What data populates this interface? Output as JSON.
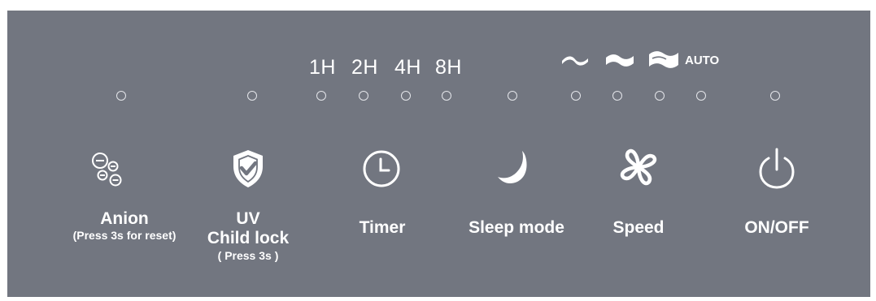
{
  "panel": {
    "background": "#727680",
    "text_color": "#ffffff"
  },
  "timer_options": [
    "1H",
    "2H",
    "4H",
    "8H"
  ],
  "speed_options": {
    "low_icon": "wind-low-icon",
    "mid_icon": "wind-mid-icon",
    "high_icon": "wind-high-icon",
    "auto_label": "AUTO"
  },
  "indicators": [
    {
      "name": "anion-led",
      "state": "off"
    },
    {
      "name": "uv-led",
      "state": "off"
    },
    {
      "name": "timer-1h-led",
      "state": "off"
    },
    {
      "name": "timer-2h-led",
      "state": "off"
    },
    {
      "name": "timer-4h-led",
      "state": "off"
    },
    {
      "name": "timer-8h-led",
      "state": "off"
    },
    {
      "name": "sleep-led",
      "state": "off"
    },
    {
      "name": "speed-low-led",
      "state": "off"
    },
    {
      "name": "speed-mid-led",
      "state": "off"
    },
    {
      "name": "speed-high-led",
      "state": "off"
    },
    {
      "name": "speed-auto-led",
      "state": "off"
    },
    {
      "name": "power-led",
      "state": "off"
    }
  ],
  "buttons": {
    "anion": {
      "label": "Anion",
      "sublabel": "(Press 3s for reset)",
      "icon": "anion-icon"
    },
    "uv": {
      "label": "UV",
      "label2": "Child lock",
      "sublabel": "( Press 3s )",
      "icon": "shield-check-icon"
    },
    "timer": {
      "label": "Timer",
      "icon": "clock-icon"
    },
    "sleep": {
      "label": "Sleep mode",
      "icon": "moon-icon"
    },
    "speed": {
      "label": "Speed",
      "icon": "fan-icon"
    },
    "power": {
      "label": "ON/OFF",
      "icon": "power-icon"
    }
  }
}
